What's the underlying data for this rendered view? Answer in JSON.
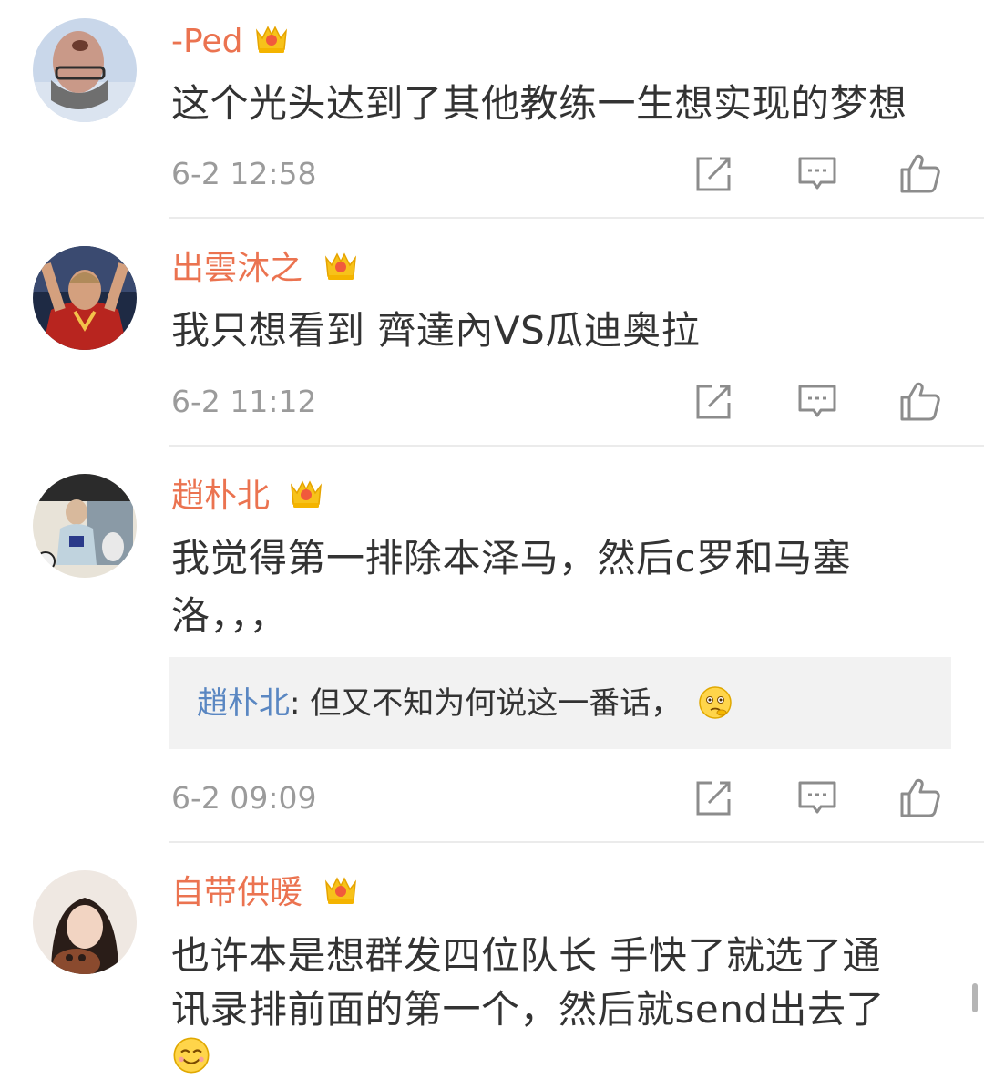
{
  "comments": [
    {
      "username": "-Ped",
      "vip_level": "5",
      "text": "这个光头达到了其他教练一生想实现的梦想",
      "time": "6-2 12:58"
    },
    {
      "username": "出雲沐之",
      "vip_level": "1",
      "text": "我只想看到 齊達內VS瓜迪奥拉",
      "time": "6-2 11:12"
    },
    {
      "username": "趙朴北",
      "vip_level": "4",
      "text_line1": "我觉得第一排除本泽马，然后c罗和马塞",
      "text_line2": "洛，，，",
      "reply_name": "趙朴北",
      "reply_text": ": 但又不知为何说这一番话，",
      "reply_emoji": "thinking-emoji",
      "time": "6-2 09:09"
    },
    {
      "username": "自带供暖",
      "vip_level": "3",
      "text_line1": "也许本是想群发四位队长 手快了就选了通",
      "text_line2": "讯录排前面的第一个，然后就send出去了",
      "text_emoji": "smile-emoji"
    }
  ],
  "icons": {
    "repost": "repost-icon",
    "comment": "comment-icon",
    "like": "like-icon",
    "crown": "vip-crown-icon"
  },
  "colors": {
    "username": "#eb7350",
    "reply_name": "#5a87c2",
    "text": "#333333",
    "meta": "#9b9b9b"
  }
}
